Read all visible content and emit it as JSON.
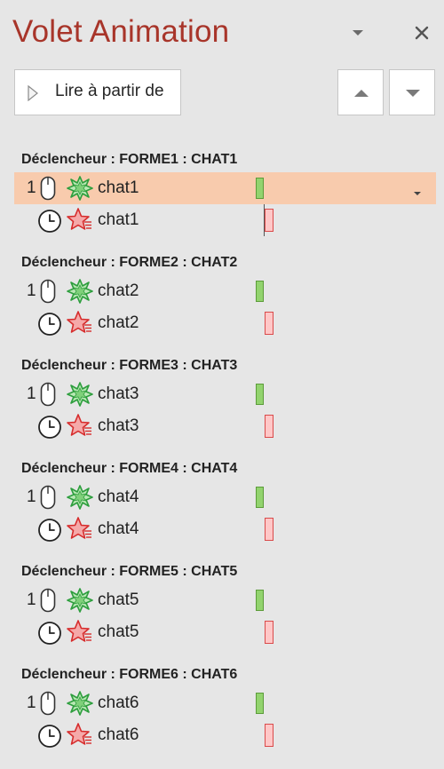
{
  "pane": {
    "title": "Volet Animation",
    "play_button_label": "Lire à partir de"
  },
  "groups": [
    {
      "trigger": "Déclencheur : FORME1 : CHAT1",
      "order": "1",
      "entrance": "chat1",
      "exit": "chat1",
      "selected": true
    },
    {
      "trigger": "Déclencheur : FORME2 : CHAT2",
      "order": "1",
      "entrance": "chat2",
      "exit": "chat2",
      "selected": false
    },
    {
      "trigger": "Déclencheur : FORME3 : CHAT3",
      "order": "1",
      "entrance": "chat3",
      "exit": "chat3",
      "selected": false
    },
    {
      "trigger": "Déclencheur : FORME4 : CHAT4",
      "order": "1",
      "entrance": "chat4",
      "exit": "chat4",
      "selected": false
    },
    {
      "trigger": "Déclencheur : FORME5 : CHAT5",
      "order": "1",
      "entrance": "chat5",
      "exit": "chat5",
      "selected": false
    },
    {
      "trigger": "Déclencheur : FORME6 : CHAT6",
      "order": "1",
      "entrance": "chat6",
      "exit": "chat6",
      "selected": false
    }
  ],
  "colors": {
    "title": "#a8352a",
    "selection": "#f8cbad",
    "entrance_effect": "#3fae49",
    "exit_effect": "#e03c3c"
  },
  "icons": {
    "play": "play-triangle-icon",
    "move_up": "triangle-up-icon",
    "move_down": "triangle-down-icon",
    "pane_options": "chevron-down-icon",
    "close": "close-icon",
    "on_click": "mouse-icon",
    "after_previous": "clock-icon",
    "entrance": "green-starburst-icon",
    "exit": "red-star-icon"
  }
}
